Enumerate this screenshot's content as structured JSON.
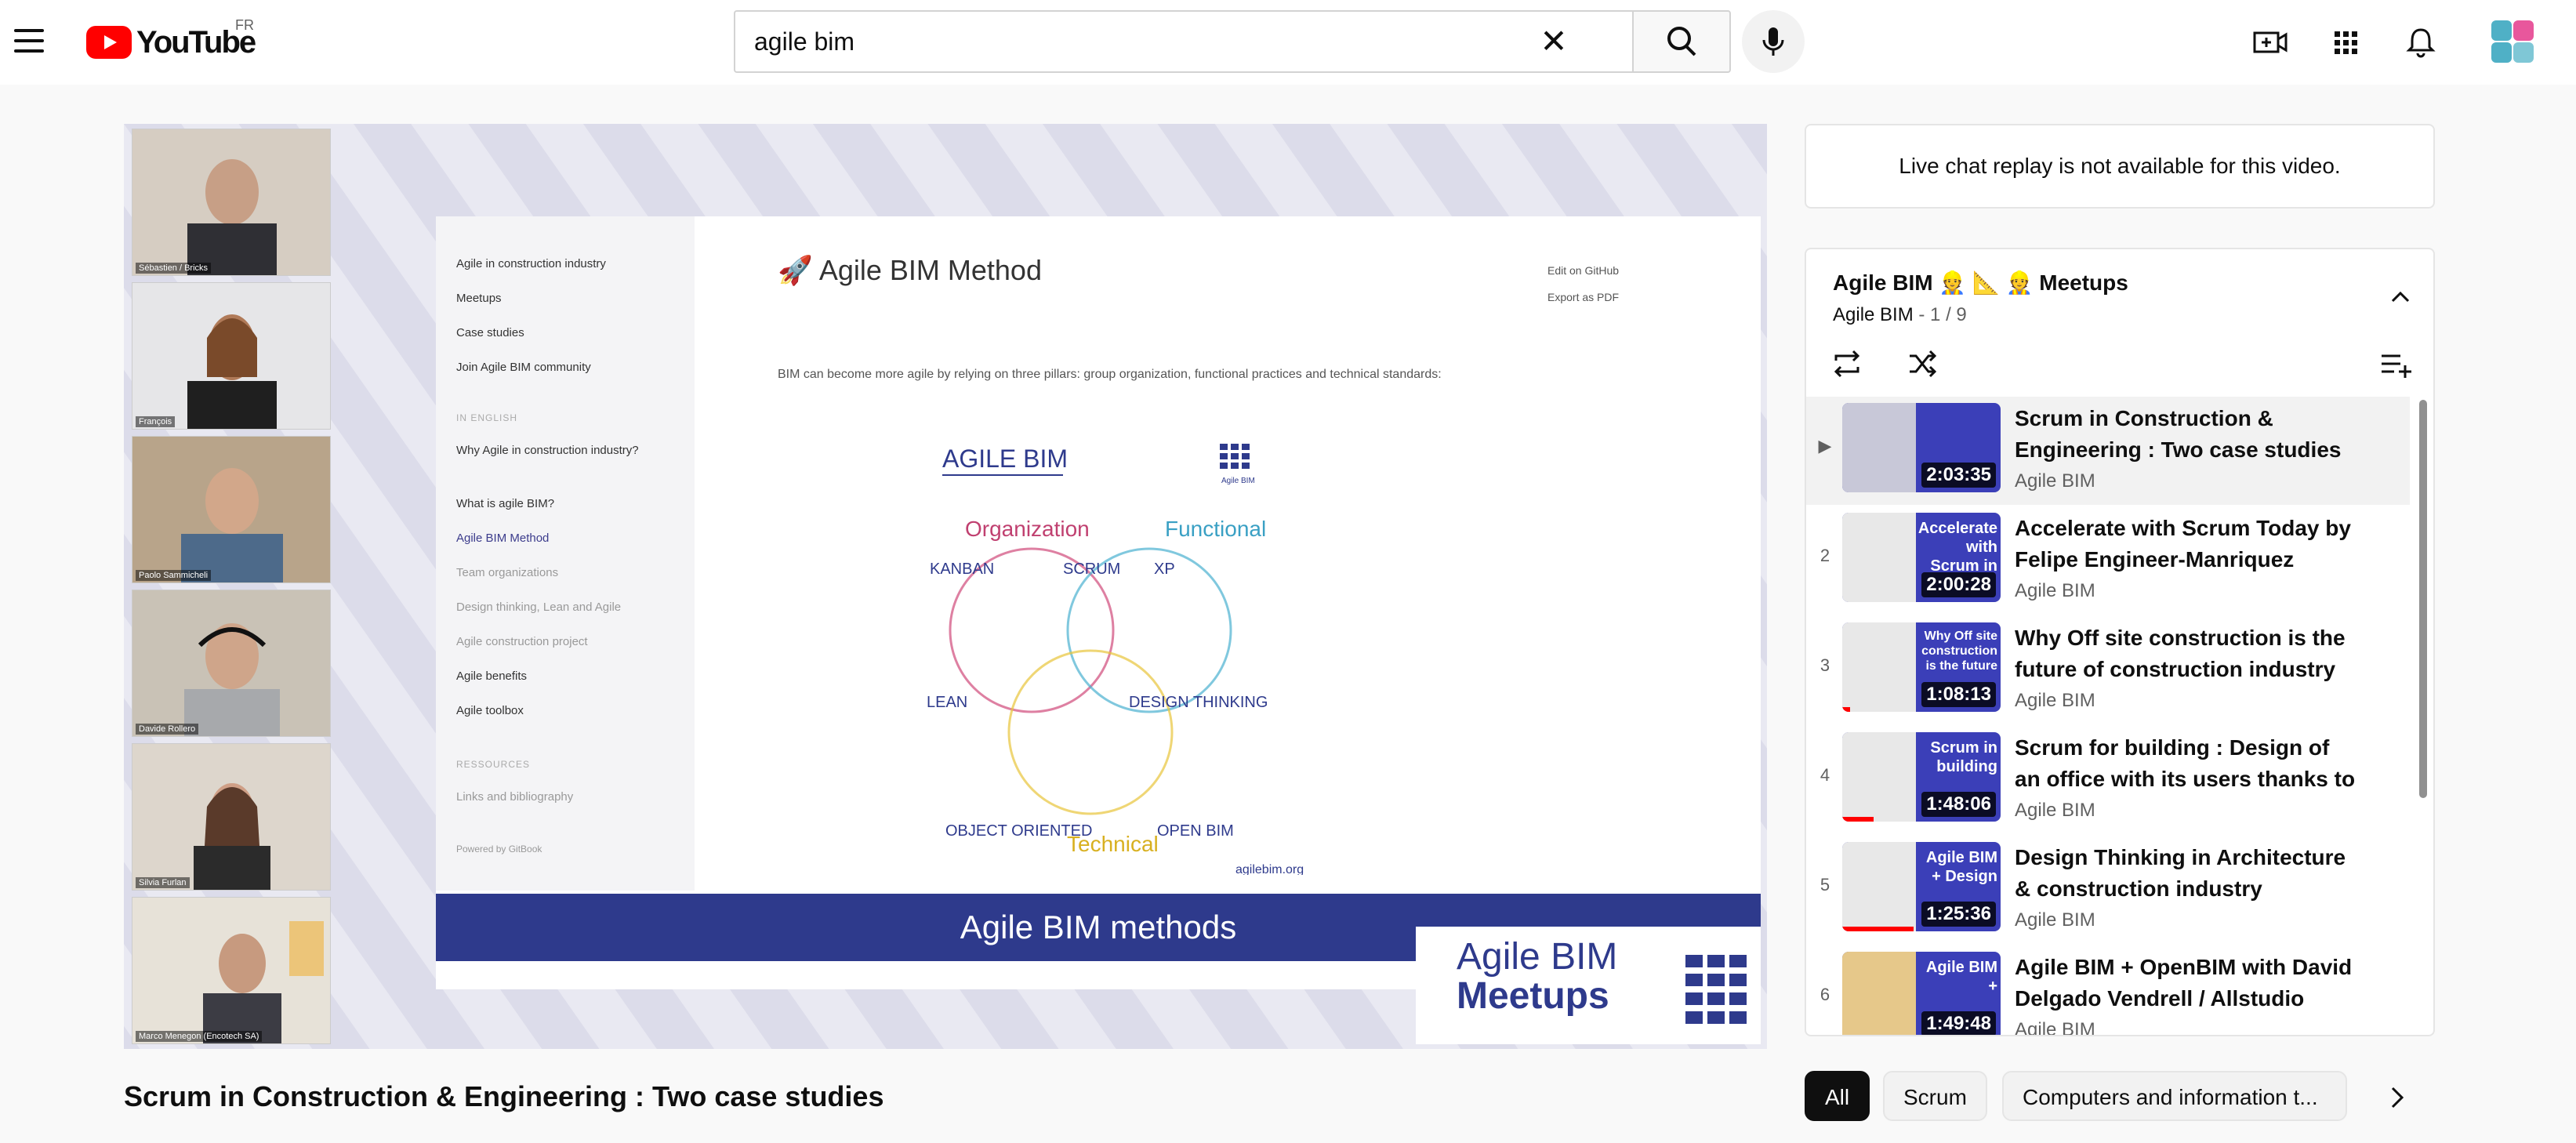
{
  "header": {
    "logo_text": "YouTube",
    "country_code": "FR",
    "search": {
      "value": "agile bim",
      "placeholder": "Search"
    }
  },
  "player": {
    "participants": [
      "Sébastien / Bricks",
      "François",
      "Paolo Sammicheli",
      "Davide Rollero",
      "Silvia Furlan",
      "Marco Menegon (Encotech SA)"
    ],
    "slide": {
      "title": "🚀 Agile BIM Method",
      "text": "BIM can become more agile by relying on three pillars: group organization, functional practices and technical standards:",
      "links": [
        "Edit on GitHub",
        "Export as PDF"
      ],
      "nav": {
        "top": "Agile in construction industry",
        "items": [
          "Meetups",
          "Case studies",
          "Join Agile BIM community"
        ],
        "section_en": "IN ENGLISH",
        "en_items": [
          "Why Agile in construction industry?",
          "What is agile BIM?",
          "Agile BIM Method",
          "Team organizations",
          "Design thinking, Lean and Agile",
          "Agile construction project",
          "Agile benefits",
          "Agile toolbox"
        ],
        "section_res": "RESSOURCES",
        "res_items": [
          "Links and bibliography"
        ],
        "footer": "Powered by GitBook"
      },
      "diagram": {
        "heading": "AGILE BIM",
        "circles": [
          "Organization",
          "Functional",
          "Technical"
        ],
        "labels": [
          "KANBAN",
          "SCRUM",
          "XP",
          "LEAN",
          "DESIGN THINKING",
          "OBJECT ORIENTED",
          "OPEN BIM"
        ],
        "site": "agilebim.org",
        "logo_caption": "Agile BIM"
      },
      "banner": "Agile BIM methods",
      "meetups_line1": "Agile BIM",
      "meetups_line2": "Meetups"
    }
  },
  "chat": {
    "message": "Live chat replay is not available for this video."
  },
  "playlist": {
    "title": "Agile BIM 👷 📐 👷 Meetups",
    "channel": "Agile BIM",
    "position": "1 / 9",
    "items": [
      {
        "index": "▶",
        "title": "Scrum in Construction & Engineering : Two case studies",
        "channel": "Agile BIM",
        "duration": "2:03:35",
        "caption": "",
        "progress": 0
      },
      {
        "index": "2",
        "title": "Accelerate with Scrum Today by Felipe Engineer-Manriquez",
        "channel": "Agile BIM",
        "duration": "2:00:28",
        "caption": "Accelerate with Scrum in",
        "progress": 0
      },
      {
        "index": "3",
        "title": "Why Off site construction is the future of construction industry",
        "channel": "Agile BIM",
        "duration": "1:08:13",
        "caption": "Why Off site construction is the future",
        "progress": 0.05
      },
      {
        "index": "4",
        "title": "Scrum for building : Design of an office with its users thanks to Scrum",
        "channel": "Agile BIM",
        "duration": "1:48:06",
        "caption": "Scrum in building",
        "progress": 0.2
      },
      {
        "index": "5",
        "title": "Design Thinking in Architecture & construction industry",
        "channel": "Agile BIM",
        "duration": "1:25:36",
        "caption": "Agile BIM + Design",
        "progress": 0.45
      },
      {
        "index": "6",
        "title": "Agile BIM + OpenBIM with David Delgado Vendrell / Allstudio",
        "channel": "Agile BIM",
        "duration": "1:49:48",
        "caption": "Agile BIM +",
        "progress": 0.1
      }
    ]
  },
  "video": {
    "title": "Scrum in Construction & Engineering : Two case studies"
  },
  "chips": [
    "All",
    "Scrum",
    "Computers and information t..."
  ],
  "colors": {
    "brand_red": "#ff0000",
    "slide_blue": "#2e3a8c",
    "thumb_blue": "#3b3fb8"
  }
}
